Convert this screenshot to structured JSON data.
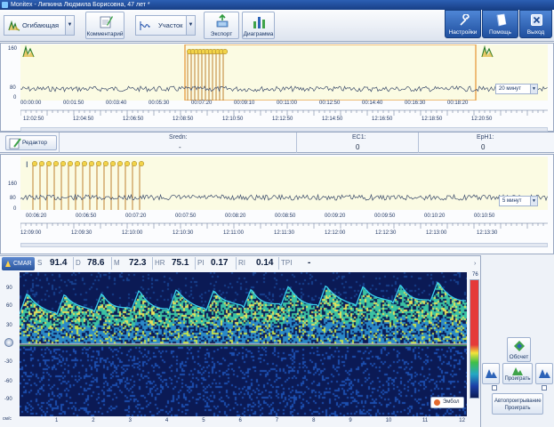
{
  "window": {
    "title": "Monitex - Липкина Людмила Борисовна, 47 лет *"
  },
  "toolbar": {
    "envelope_label": "Огибающая",
    "comment_label": "Комментарий",
    "section_label": "Участок",
    "export_label": "Экспорт",
    "diagram_label": "Диаграмма",
    "settings_label": "Настройки",
    "help_label": "Помощь",
    "exit_label": "Выход"
  },
  "trend1": {
    "y_ticks": [
      "160",
      "80",
      "0"
    ],
    "top_ticks": [
      "00:00:00",
      "00:01:50",
      "00:03:40",
      "00:05:30",
      "00:07:20",
      "00:09:10",
      "00:11:00",
      "00:12:50",
      "00:14:40",
      "00:16:30",
      "00:18:20"
    ],
    "bottom_ticks": [
      "12:02:50",
      "12:04:50",
      "12:06:50",
      "12:08:50",
      "12:10:50",
      "12:12:50",
      "12:14:50",
      "12:16:50",
      "12:18:50",
      "12:20:50"
    ],
    "scale_value": "20 минут"
  },
  "stats": {
    "editor_label": "Редактор",
    "sredn_label": "Sredn:",
    "sredn_value": "-",
    "ec1_label": "EC1:",
    "ec1_value": "0",
    "eph1_label": "EpH1:",
    "eph1_value": "0"
  },
  "trend2": {
    "marker": "I",
    "y_ticks": [
      "160",
      "80",
      "0"
    ],
    "top_ticks": [
      "00:06:20",
      "00:06:50",
      "00:07:20",
      "00:07:50",
      "00:08:20",
      "00:08:50",
      "00:09:20",
      "00:09:50",
      "00:10:20",
      "00:10:50"
    ],
    "bottom_ticks": [
      "12:09:00",
      "12:09:30",
      "12:10:00",
      "12:10:30",
      "12:11:00",
      "12:11:30",
      "12:12:00",
      "12:12:30",
      "12:13:00",
      "12:13:30"
    ],
    "scale_value": "5 минут"
  },
  "params": {
    "vessel": "CMAR",
    "s_label": "S",
    "s_value": "91.4",
    "d_label": "D",
    "d_value": "78.6",
    "m_label": "M",
    "m_value": "72.3",
    "hr_label": "HR",
    "hr_value": "75.1",
    "pi_label": "PI",
    "pi_value": "0.17",
    "ri_label": "RI",
    "ri_value": "0.14",
    "tpi_label": "TPI",
    "tpi_value": "-"
  },
  "spectrum": {
    "y_ticks": [
      "90",
      "60",
      "30",
      "0",
      "-30",
      "-60",
      "-90"
    ],
    "y_unit": "см/с",
    "x_ticks": [
      "1",
      "2",
      "3",
      "4",
      "5",
      "6",
      "7",
      "8",
      "9",
      "10",
      "11",
      "12"
    ],
    "scale_top": "76",
    "emboli_label": "Эмбол"
  },
  "sidebar": {
    "recalc_label": "Обсчет",
    "play_label": "Проиграть",
    "autoplay_label": "Автопроигрывание Проиграть"
  },
  "colors": {
    "titlebar": "#1f4a98",
    "trend_selection": "#e8a24a",
    "spectrum_bg": "#0b1a55",
    "envelope": "#39d2ee"
  }
}
